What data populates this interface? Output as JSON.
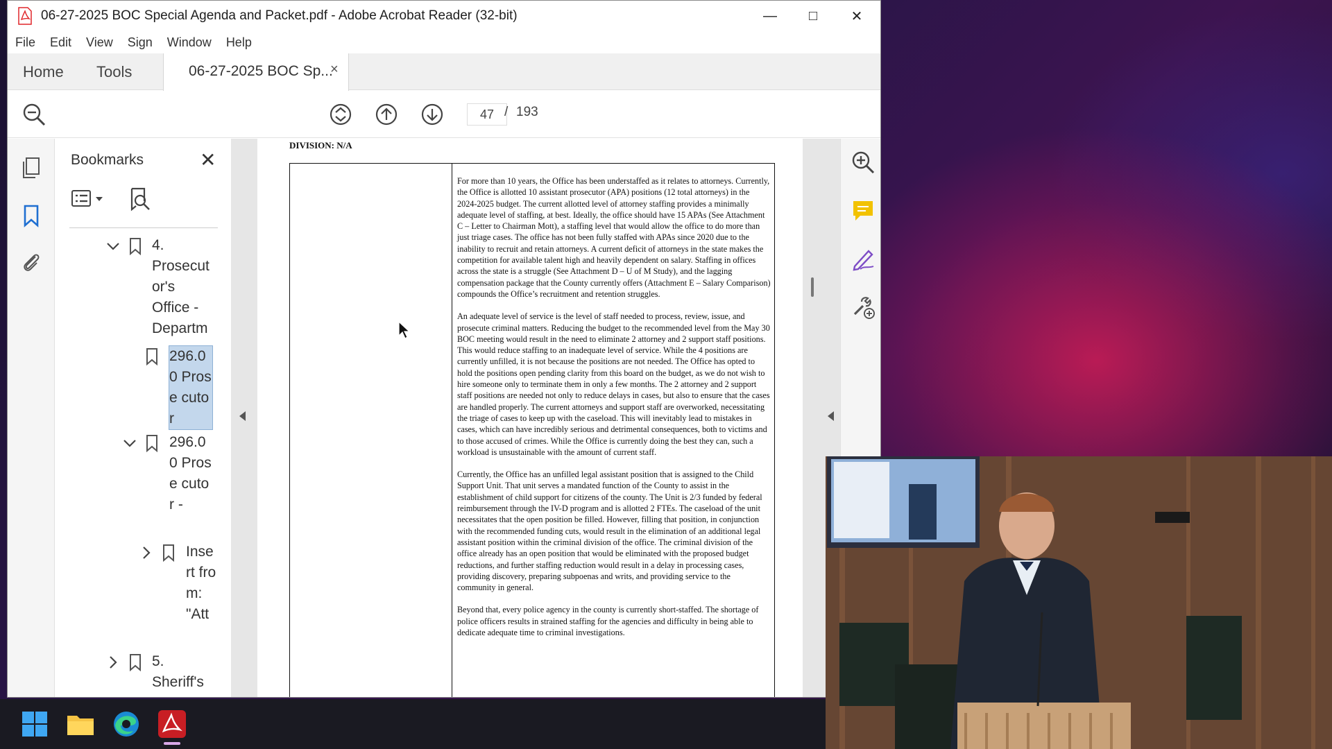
{
  "window": {
    "title": "06-27-2025 BOC Special Agenda and Packet.pdf - Adobe Acrobat Reader (32-bit)",
    "minimize": "—",
    "maximize": "□",
    "close": "✕"
  },
  "menu": {
    "items": [
      {
        "label": "File"
      },
      {
        "label": "Edit"
      },
      {
        "label": "View"
      },
      {
        "label": "Sign"
      },
      {
        "label": "Window"
      },
      {
        "label": "Help"
      }
    ]
  },
  "tabs": {
    "home": "Home",
    "tools": "Tools",
    "document": "06-27-2025 BOC Sp...",
    "document_close": "×"
  },
  "toolbar": {
    "current_page": "47",
    "separator": "/",
    "total_pages": "193"
  },
  "bookmarks": {
    "title": "Bookmarks",
    "close": "✕",
    "items": [
      {
        "text": "4. Prosecut or's Office  - Departm",
        "expanded": true,
        "selected": false
      },
      {
        "text": "296.0 0 Prose cutor",
        "expanded": null,
        "selected": true
      },
      {
        "text": "296.0 0 Prose cutor -",
        "expanded": true,
        "selected": false
      },
      {
        "text": "Inse rt fro m: \"Att",
        "expanded": false,
        "selected": false
      },
      {
        "text": "5. Sheriff's",
        "expanded": false,
        "selected": false
      }
    ]
  },
  "document": {
    "division": "DIVISION: N/A",
    "paragraphs": [
      "For more than 10 years, the Office has been understaffed as it relates to attorneys. Currently, the Office is allotted 10 assistant prosecutor (APA) positions (12 total attorneys) in the 2024-2025 budget. The current allotted level of attorney staffing provides a minimally adequate level of staffing, at best. Ideally, the office should have 15 APAs (See Attachment C – Letter to Chairman Mott), a staffing level that would allow the office to do more than just triage cases. The office has not been fully staffed with APAs since 2020 due to the inability to recruit and retain attorneys. A current deficit of attorneys in the state makes the competition for available talent high and heavily dependent on salary. Staffing in offices across the state is a struggle (See Attachment D – U of M Study), and the lagging compensation package that the County currently offers (Attachment E – Salary Comparison) compounds the Office’s recruitment and retention struggles.",
      "An adequate level of service is the level of staff needed to process, review, issue, and prosecute criminal matters. Reducing the budget to the recommended level from the May 30 BOC meeting would result in the need to eliminate 2 attorney and 2 support staff positions. This would reduce staffing to an inadequate level of service. While the 4 positions are currently unfilled, it is not because the positions are not needed. The Office has opted to hold the positions open pending clarity from this board on the budget, as we do not wish to hire someone only to terminate them in only a few months. The 2 attorney and 2 support staff positions are needed not only to reduce delays in cases, but also to ensure that the cases are handled properly. The current attorneys and support staff are overworked, necessitating the triage of cases to keep up with the caseload. This will inevitably lead to mistakes in cases, which can have incredibly serious and detrimental consequences, both to victims and to those accused of crimes. While the Office is currently doing the best they can, such a workload is unsustainable with the amount of current staff.",
      "Currently, the Office has an unfilled legal assistant position that is assigned to the Child Support Unit. That unit serves a mandated function of the County to assist in the establishment of child support for citizens of the county. The Unit is 2/3 funded by federal reimbursement through the IV-D program and is allotted 2 FTEs. The caseload of the unit necessitates that the open position be filled. However, filling that position, in conjunction with the recommended funding cuts, would result in the elimination of an additional legal assistant position within the criminal division of the office. The criminal division of the office already has an open position that would be eliminated with the proposed budget reductions, and further staffing reduction would result in a delay in processing cases, providing discovery, preparing subpoenas and writs, and providing service to the community in general.",
      "Beyond that, every police agency in the county is currently short-staffed. The shortage of police officers results in strained staffing for the agencies and difficulty in being able to dedicate adequate time to criminal investigations."
    ]
  },
  "colors": {
    "acrobat_red": "#e0262a",
    "bookmark_blue": "#1f6fd1",
    "comment_yellow": "#f2c200",
    "sign_purple": "#7d4cc6",
    "selection": "#c3d7ec"
  },
  "taskbar": {
    "apps": [
      "windows-start-icon",
      "file-explorer-icon",
      "edge-browser-icon",
      "acrobat-reader-icon"
    ]
  }
}
